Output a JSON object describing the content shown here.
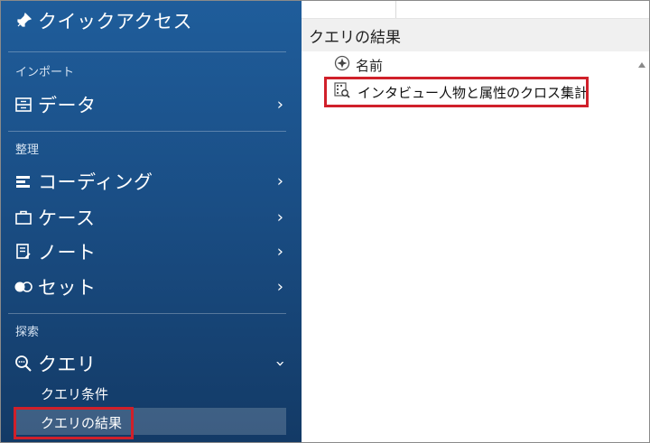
{
  "sidebar": {
    "quick_access": "クイックアクセス",
    "sections": {
      "import": "インポート",
      "organize": "整理",
      "explore": "探索"
    },
    "items": {
      "data": "データ",
      "coding": "コーディング",
      "cases": "ケース",
      "notes": "ノート",
      "sets": "セット",
      "query": "クエリ"
    },
    "query_sub": {
      "criteria": "クエリ条件",
      "results": "クエリの結果"
    }
  },
  "main": {
    "header": "クエリの結果",
    "column_name": "名前",
    "rows": [
      "インタビュー人物と属性のクロス集計"
    ]
  },
  "colors": {
    "sidebar_top": "#1f5d9b",
    "sidebar_bottom": "#133a66",
    "highlight_border": "#d0202a"
  }
}
